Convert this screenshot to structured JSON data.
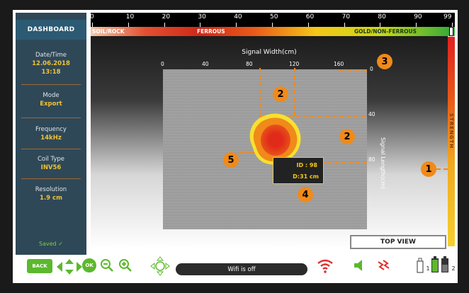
{
  "sidebar": {
    "dashboard_label": "DASHBOARD",
    "datetime_label": "Date/Time",
    "date_value": "12.06.2018",
    "time_value": "13:18",
    "mode_label": "Mode",
    "mode_value": "Export",
    "frequency_label": "Frequency",
    "frequency_value": "14kHz",
    "coil_label": "Coil Type",
    "coil_value": "INV56",
    "resolution_label": "Resolution",
    "resolution_value": "1.9 cm",
    "saved_label": "Saved ✓"
  },
  "ruler": {
    "ticks": [
      "0",
      "10",
      "20",
      "30",
      "40",
      "50",
      "60",
      "70",
      "80",
      "90",
      "99"
    ]
  },
  "conductivity": {
    "left_label": "SOIL/ROCK",
    "mid_label": "FERROUS",
    "right_label": "GOLD/NON-FERROUS"
  },
  "plot": {
    "x_title": "Signal Width(cm)",
    "x_ticks": [
      "0",
      "40",
      "80",
      "120",
      "160"
    ],
    "y_title": "Signal Length(cm)",
    "y_ticks": [
      "0",
      "40",
      "80"
    ],
    "target_id": "ID : 98",
    "target_depth": "D:31 cm"
  },
  "strength_label": "STRENGTH",
  "view_label": "TOP VIEW",
  "callouts": [
    "1",
    "2",
    "2",
    "3",
    "4",
    "5"
  ],
  "bottom": {
    "back_label": "BACK",
    "ok_label": "OK",
    "wifi_status": "Wifi is off",
    "battery1_label": "1",
    "battery2_label": "2"
  },
  "colors": {
    "sidebar_bg": "#2f4857",
    "accent_value": "#f1c232",
    "callout": "#f08a1a",
    "wifi_off": "#e03030",
    "ok_green": "#5cb82c"
  }
}
